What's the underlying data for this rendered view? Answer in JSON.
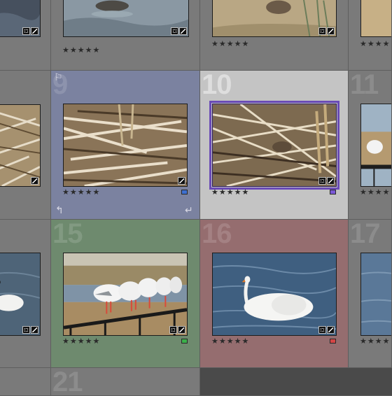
{
  "grid": {
    "cells": [
      {
        "id": "r1c0",
        "number": "",
        "rating": "★★★★★",
        "label_color": ""
      },
      {
        "id": "r1c1",
        "number": "",
        "rating": "★★★★★",
        "label_color": ""
      },
      {
        "id": "r1c2",
        "number": "",
        "rating": "★★★★★",
        "label_color": ""
      },
      {
        "id": "r1c3",
        "number": "",
        "rating": "★★★★",
        "label_color": ""
      },
      {
        "id": "r2c0",
        "number": "",
        "rating": "",
        "label_color": ""
      },
      {
        "id": "r2c1",
        "number": "9",
        "rating": "★★★★★",
        "label_color": "blue"
      },
      {
        "id": "r2c2",
        "number": "10",
        "rating": "★★★★★",
        "label_color": "purple",
        "selected": true
      },
      {
        "id": "r2c3",
        "number": "11",
        "rating": "★★★★",
        "label_color": ""
      },
      {
        "id": "r3c0",
        "number": "",
        "rating": "",
        "label_color": ""
      },
      {
        "id": "r3c1",
        "number": "15",
        "rating": "★★★★★",
        "label_color": "green"
      },
      {
        "id": "r3c2",
        "number": "16",
        "rating": "★★★★★",
        "label_color": "red"
      },
      {
        "id": "r3c3",
        "number": "17",
        "rating": "★★★★",
        "label_color": ""
      },
      {
        "id": "r4c1",
        "number": "21",
        "rating": "",
        "label_color": ""
      }
    ]
  },
  "colors": {
    "blue": "#3d6fd0",
    "purple": "#7a58d6",
    "green": "#3bb04a",
    "red": "#d44545",
    "selection": "#6a4bb6"
  },
  "icons": {
    "metadata_badge": "metadata-icon",
    "develop_badge": "develop-adjust-icon",
    "rotate_left": "rotate-left-icon",
    "rotate_right": "rotate-right-icon",
    "flag": "flag-icon"
  },
  "photos": {
    "r1c1": "duck on water",
    "r1c2": "bird on grass",
    "r2c1": "dry reeds",
    "r2c2": "bird hidden in reeds",
    "r2c3": "gulp on railing",
    "r3c0": "swan on water",
    "r3c1": "gulls on railing",
    "r3c2": "white swan",
    "r3c3": "water"
  }
}
